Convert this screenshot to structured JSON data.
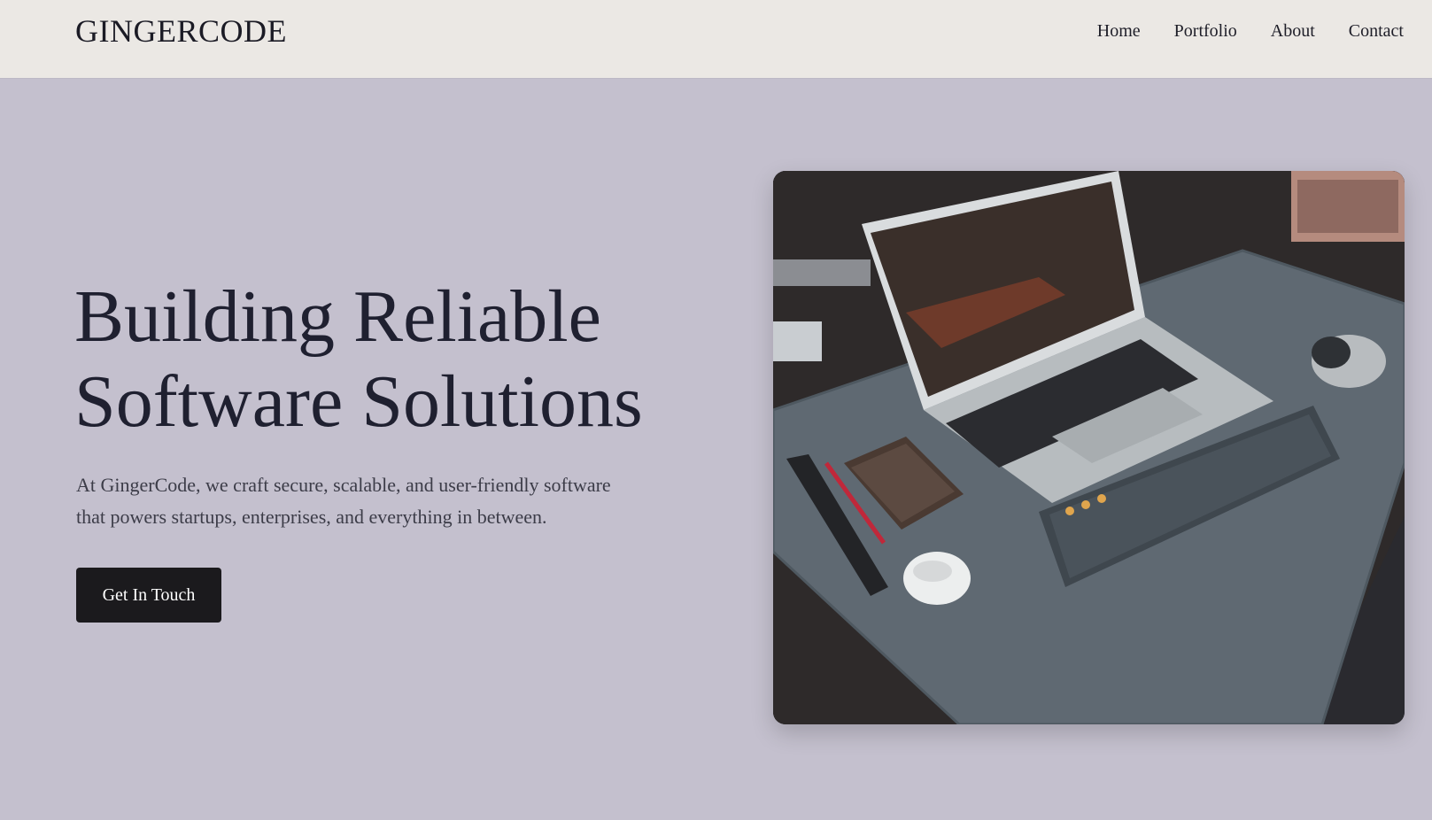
{
  "brand": "GINGERCODE",
  "nav": {
    "items": [
      {
        "label": "Home"
      },
      {
        "label": "Portfolio"
      },
      {
        "label": "About"
      },
      {
        "label": "Contact"
      }
    ]
  },
  "hero": {
    "title_line1": "Building Reliable",
    "title_line2": "Software Solutions",
    "description": "At GingerCode, we craft secure, scalable, and user-friendly software that powers startups, enterprises, and everything in between.",
    "cta_label": "Get In Touch"
  },
  "image": {
    "description_icon": "desk-setup-photo"
  },
  "colors": {
    "page_bg": "#c4c0ce",
    "header_bg": "#ebe8e4",
    "title": "#1f2030",
    "body_text": "#3c3c48",
    "cta_bg": "#1b1a1d"
  }
}
